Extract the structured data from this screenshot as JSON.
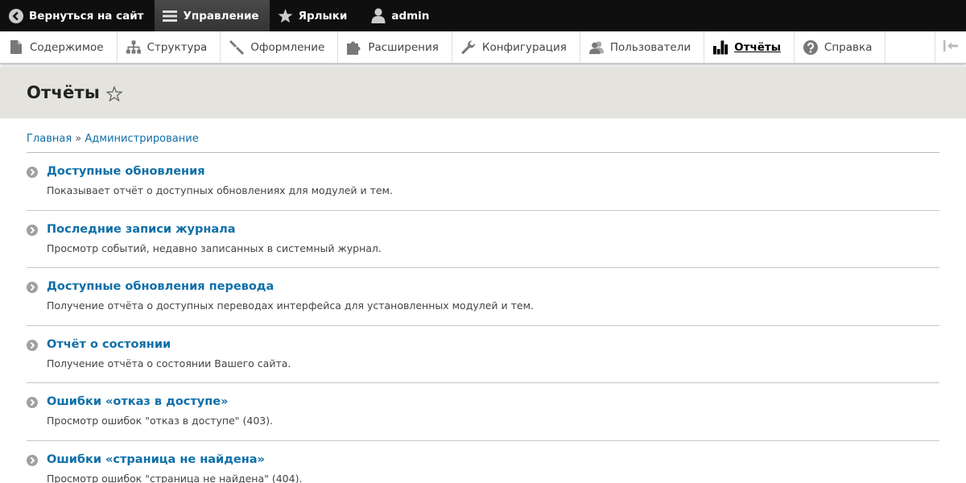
{
  "toolbar": {
    "back": "Вернуться на сайт",
    "manage": "Управление",
    "shortcuts": "Ярлыки",
    "user": "admin"
  },
  "tray": {
    "items": [
      {
        "label": "Содержимое",
        "icon": "file-icon"
      },
      {
        "label": "Структура",
        "icon": "structure-icon"
      },
      {
        "label": "Оформление",
        "icon": "brush-icon"
      },
      {
        "label": "Расширения",
        "icon": "puzzle-icon"
      },
      {
        "label": "Конфигурация",
        "icon": "wrench-icon"
      },
      {
        "label": "Пользователи",
        "icon": "users-icon"
      },
      {
        "label": "Отчёты",
        "icon": "bar-chart-icon"
      },
      {
        "label": "Справка",
        "icon": "help-icon"
      }
    ],
    "active": "Отчёты"
  },
  "page": {
    "title": "Отчёты"
  },
  "breadcrumb": {
    "home": "Главная",
    "separator": "»",
    "admin": "Администрирование"
  },
  "entries": [
    {
      "title": "Доступные обновления",
      "desc": "Показывает отчёт о доступных обновлениях для модулей и тем."
    },
    {
      "title": "Последние записи журнала",
      "desc": "Просмотр событий, недавно записанных в системный журнал."
    },
    {
      "title": "Доступные обновления перевода",
      "desc": "Получение отчёта о доступных переводах интерфейса для установленных модулей и тем."
    },
    {
      "title": "Отчёт о состоянии",
      "desc": "Получение отчёта о состоянии Вашего сайта."
    },
    {
      "title": "Ошибки «отказ в доступе»",
      "desc": "Просмотр ошибок \"отказ в доступе\" (403)."
    },
    {
      "title": "Ошибки «страница не найдена»",
      "desc": "Просмотр ошибок \"страница не найдена\" (404)."
    }
  ],
  "colors": {
    "link": "#0f6fa8",
    "toolbar_bg": "#0f0f0f",
    "header_bg": "#e4e3dd"
  }
}
